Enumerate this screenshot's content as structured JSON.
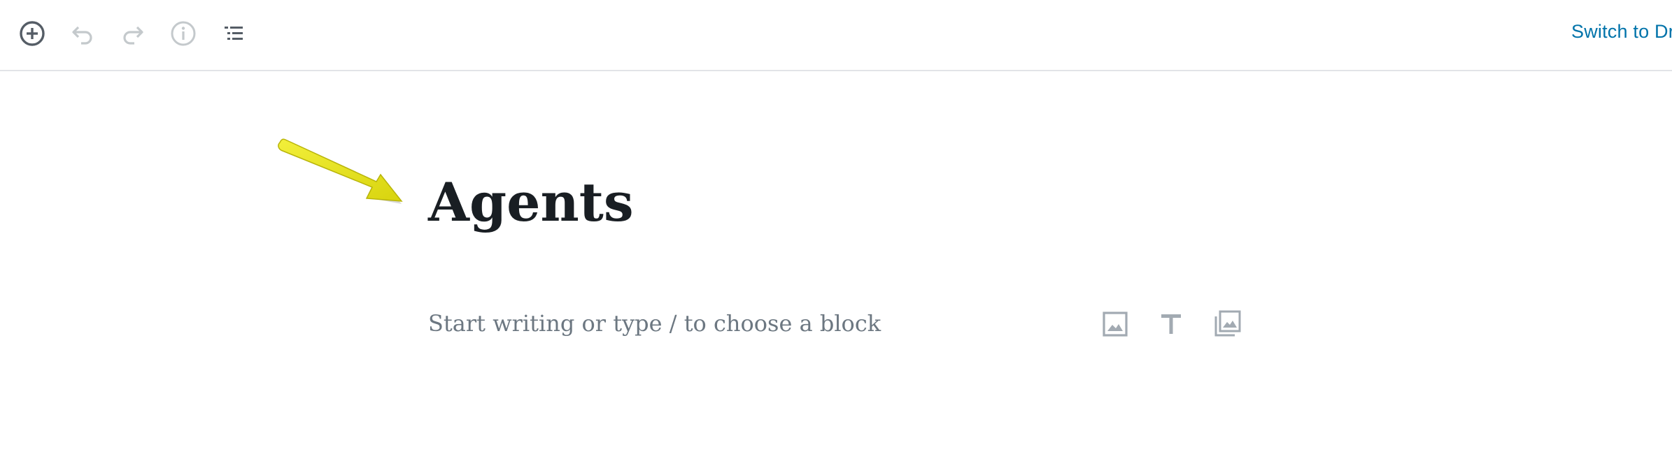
{
  "toolbar": {
    "add_block_icon": "plus-circle-icon",
    "undo_icon": "undo-icon",
    "redo_icon": "redo-icon",
    "info_icon": "info-icon",
    "outline_icon": "list-view-icon",
    "switch_to_draft": "Switch to Dr"
  },
  "editor": {
    "title": "Agents",
    "placeholder": "Start writing or type / to choose a block"
  },
  "inserter": [
    {
      "icon": "image-icon"
    },
    {
      "icon": "heading-icon"
    },
    {
      "icon": "gallery-icon"
    }
  ],
  "annotation": {
    "icon": "yellow-arrow-icon",
    "color": "#e8e41a"
  },
  "colors": {
    "accent": "#0073aa",
    "title": "#191e23",
    "placeholder": "#6c7781",
    "icon_active": "#555d66",
    "icon_disabled": "#c4c9cc"
  }
}
